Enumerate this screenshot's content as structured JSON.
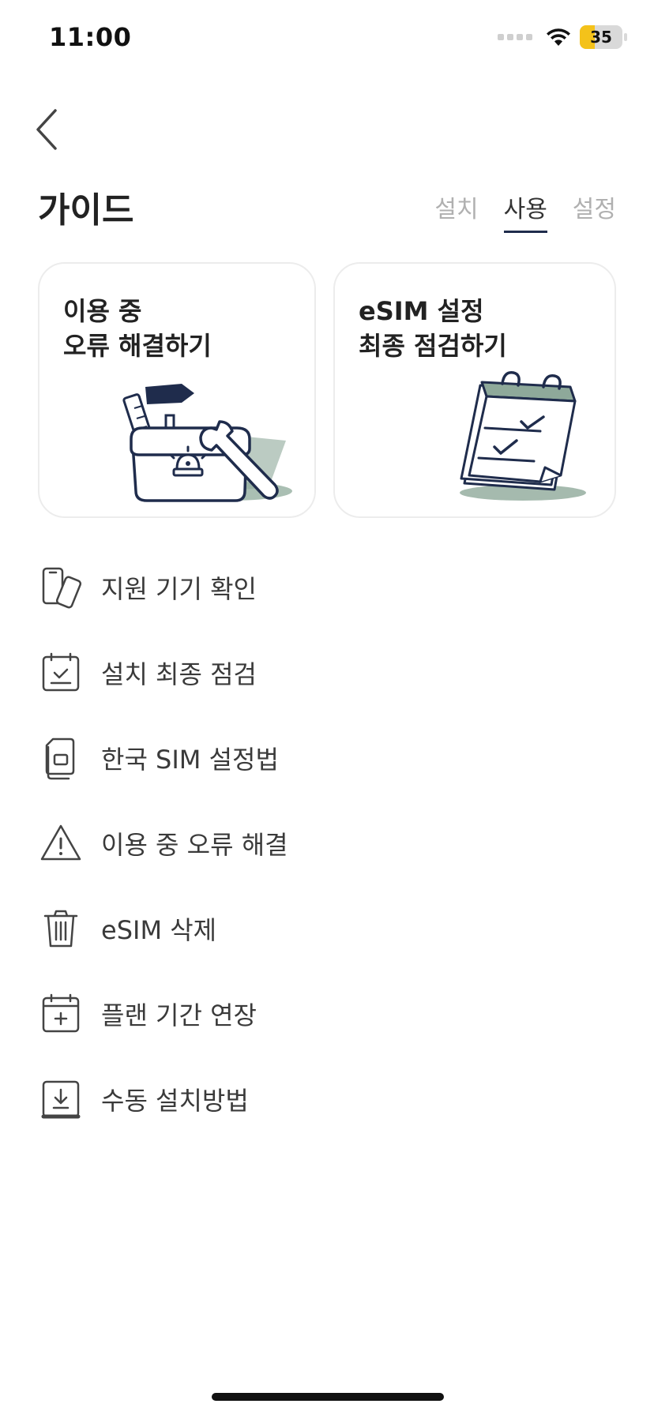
{
  "status_bar": {
    "time": "11:00",
    "battery": "35",
    "battery_level": 0.35
  },
  "header": {
    "title": "가이드"
  },
  "tabs": [
    {
      "label": "설치",
      "active": false
    },
    {
      "label": "사용",
      "active": true
    },
    {
      "label": "설정",
      "active": false
    }
  ],
  "cards": [
    {
      "line1": "이용 중",
      "line2": "오류 해결하기",
      "icon": "toolbox-illustration"
    },
    {
      "line1": "eSIM 설정",
      "line2": "최종 점검하기",
      "icon": "checklist-calendar-illustration"
    }
  ],
  "menu": [
    {
      "label": "지원 기기 확인",
      "icon": "devices-icon"
    },
    {
      "label": "설치 최종 점검",
      "icon": "calendar-check-icon"
    },
    {
      "label": "한국 SIM 설정법",
      "icon": "sim-card-icon"
    },
    {
      "label": "이용 중 오류 해결",
      "icon": "warning-icon"
    },
    {
      "label": "eSIM 삭제",
      "icon": "trash-icon"
    },
    {
      "label": "플랜 기간 연장",
      "icon": "calendar-plus-icon"
    },
    {
      "label": "수동 설치방법",
      "icon": "download-icon"
    }
  ],
  "colors": {
    "navy": "#1f2c4c",
    "sage": "#8ea99a",
    "inactive_tab": "#b0b0b0",
    "battery": "#f4c21a"
  }
}
